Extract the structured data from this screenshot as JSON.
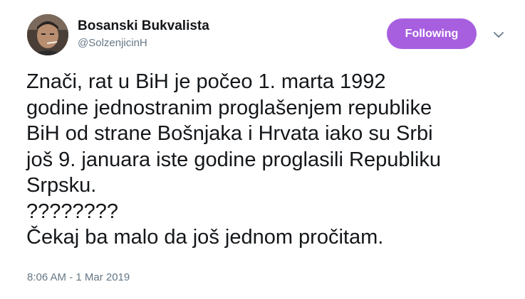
{
  "header": {
    "display_name": "Bosanski Bukvalista",
    "handle": "@SolzenjicinH",
    "follow_button_label": "Following",
    "avatar_icon": "user-avatar-photo",
    "caret_icon": "chevron-down-icon"
  },
  "tweet": {
    "text": "Znači, rat u BiH je počeo 1. marta 1992\ngodine jednostranim proglašenjem republike\nBiH od strane Bošnjaka i Hrvata iako su Srbi\njoš 9. januara iste godine proglasili Republiku\nSrpsku.\n????????\nČekaj ba malo da još jednom pročitam.",
    "timestamp": "8:06 AM - 1 Mar 2019"
  },
  "colors": {
    "accent": "#a75fe0",
    "text_primary": "#14171a",
    "text_secondary": "#657786",
    "background": "#ffffff"
  }
}
